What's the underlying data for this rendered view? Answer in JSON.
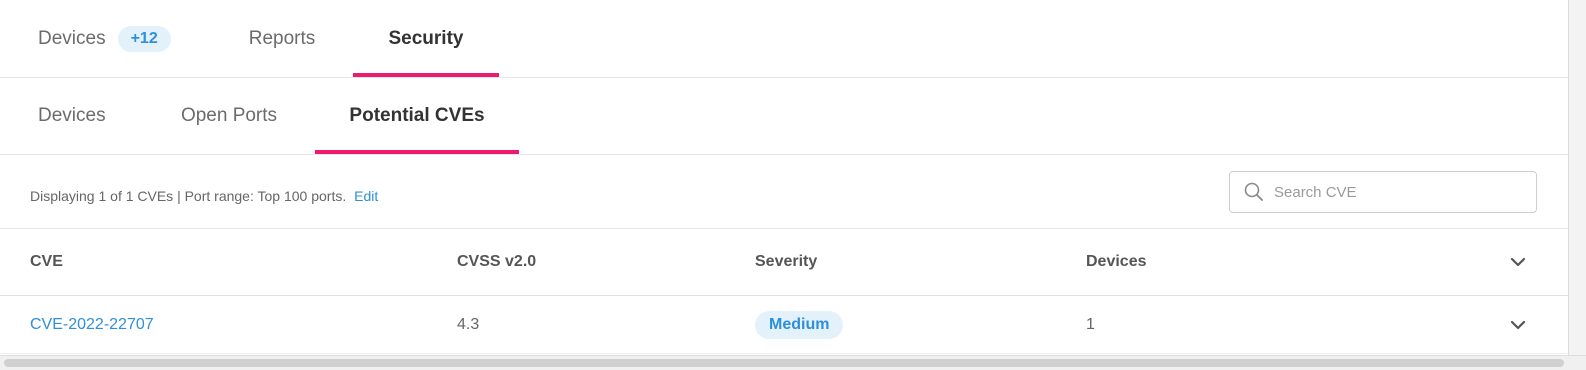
{
  "colors": {
    "accent": "#ee1a6b",
    "link": "#2f8fd8",
    "badge_bg": "#e3f1fb",
    "badge_text": "#2f8fd8",
    "severity_medium_bg": "#e3f1fb",
    "severity_medium_text": "#2f8fd8"
  },
  "primary_tabs": [
    {
      "label": "Devices",
      "badge": "+12",
      "active": false
    },
    {
      "label": "Reports",
      "active": false
    },
    {
      "label": "Security",
      "active": true
    }
  ],
  "secondary_tabs": [
    {
      "label": "Devices",
      "active": false
    },
    {
      "label": "Open Ports",
      "active": false
    },
    {
      "label": "Potential CVEs",
      "active": true
    }
  ],
  "filter": {
    "summary": "Displaying 1 of 1 CVEs | Port range: Top 100 ports.",
    "edit_label": "Edit",
    "search_placeholder": "Search CVE",
    "search_value": "",
    "search_icon": "search-icon"
  },
  "table": {
    "columns": [
      "CVE",
      "CVSS v2.0",
      "Severity",
      "Devices"
    ],
    "header_toggle_icon": "chevron-down-icon",
    "rows": [
      {
        "cve": "CVE-2022-22707",
        "cvss": "4.3",
        "severity": "Medium",
        "devices": "1",
        "expand_icon": "chevron-down-icon"
      }
    ]
  }
}
